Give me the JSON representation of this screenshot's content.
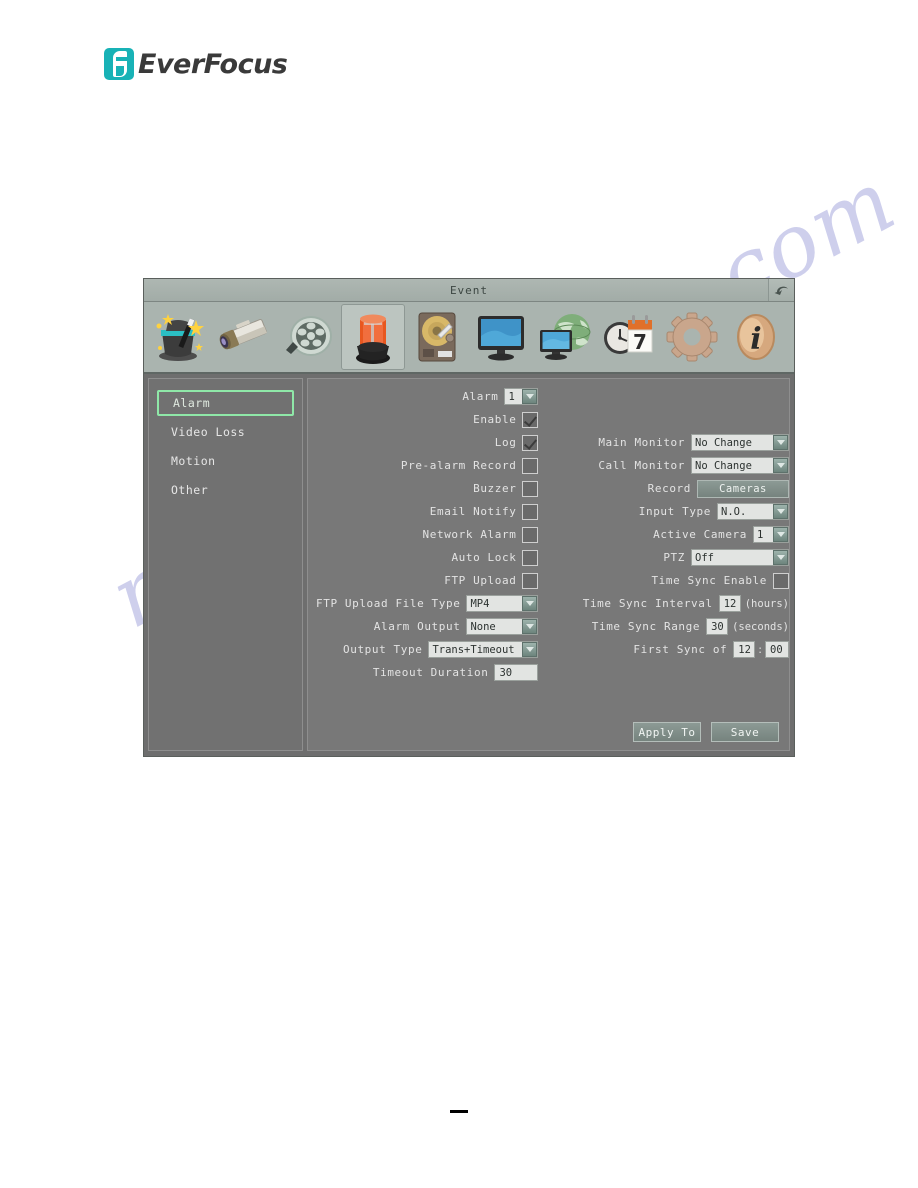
{
  "brand": {
    "name": "EverFocus",
    "logo_icon": "everfocus-f-icon",
    "accent_color": "#18b2b6"
  },
  "watermark": {
    "text": "manualarchive.com",
    "color": "#8b8fd4"
  },
  "window": {
    "title": "Event",
    "back_icon": "back-arrow-icon",
    "background_color": "#6e6e6e",
    "titlebar_color": "#aeb7b2"
  },
  "toolbar": {
    "icons": [
      {
        "name": "wizard-icon",
        "label": "Wizard",
        "selected": false
      },
      {
        "name": "camera-icon",
        "label": "Camera",
        "selected": false
      },
      {
        "name": "film-reel-icon",
        "label": "Record",
        "selected": false
      },
      {
        "name": "alarm-beacon-icon",
        "label": "Event",
        "selected": true
      },
      {
        "name": "hard-disk-icon",
        "label": "Disk",
        "selected": false
      },
      {
        "name": "monitor-icon",
        "label": "Display",
        "selected": false
      },
      {
        "name": "network-globe-icon",
        "label": "Network",
        "selected": false
      },
      {
        "name": "clock-calendar-icon",
        "label": "Schedule",
        "selected": false
      },
      {
        "name": "gear-icon",
        "label": "System",
        "selected": false
      },
      {
        "name": "info-icon",
        "label": "Information",
        "selected": false
      }
    ]
  },
  "sidebar": {
    "items": [
      {
        "label": "Alarm",
        "active": true
      },
      {
        "label": "Video Loss",
        "active": false
      },
      {
        "label": "Motion",
        "active": false
      },
      {
        "label": "Other",
        "active": false
      }
    ]
  },
  "form": {
    "left": {
      "alarm": {
        "label": "Alarm",
        "value": "1"
      },
      "enable": {
        "label": "Enable",
        "checked": true
      },
      "log": {
        "label": "Log",
        "checked": true
      },
      "pre_alarm_record": {
        "label": "Pre-alarm Record",
        "checked": false
      },
      "buzzer": {
        "label": "Buzzer",
        "checked": false
      },
      "email_notify": {
        "label": "Email Notify",
        "checked": false
      },
      "network_alarm": {
        "label": "Network Alarm",
        "checked": false
      },
      "auto_lock": {
        "label": "Auto Lock",
        "checked": false
      },
      "ftp_upload": {
        "label": "FTP Upload",
        "checked": false
      },
      "ftp_upload_file_type": {
        "label": "FTP Upload File Type",
        "value": "MP4"
      },
      "alarm_output": {
        "label": "Alarm Output",
        "value": "None"
      },
      "output_type": {
        "label": "Output Type",
        "value": "Trans+Timeout"
      },
      "timeout_duration": {
        "label": "Timeout Duration",
        "value": "30"
      }
    },
    "right": {
      "main_monitor": {
        "label": "Main Monitor",
        "value": "No Change"
      },
      "call_monitor": {
        "label": "Call Monitor",
        "value": "No Change"
      },
      "record": {
        "label": "Record",
        "button_label": "Cameras"
      },
      "input_type": {
        "label": "Input Type",
        "value": "N.O."
      },
      "active_camera": {
        "label": "Active Camera",
        "value": "1"
      },
      "ptz": {
        "label": "PTZ",
        "value": "Off"
      },
      "time_sync_enable": {
        "label": "Time Sync Enable",
        "checked": false
      },
      "time_sync_interval": {
        "label": "Time Sync Interval",
        "value": "12",
        "unit": "(hours)"
      },
      "time_sync_range": {
        "label": "Time Sync Range",
        "value": "30",
        "unit": "(seconds)"
      },
      "first_sync_of": {
        "label": "First Sync of",
        "hour": "12",
        "minute": "00",
        "separator": ":"
      }
    }
  },
  "footer": {
    "apply_to": "Apply To",
    "save": "Save"
  }
}
